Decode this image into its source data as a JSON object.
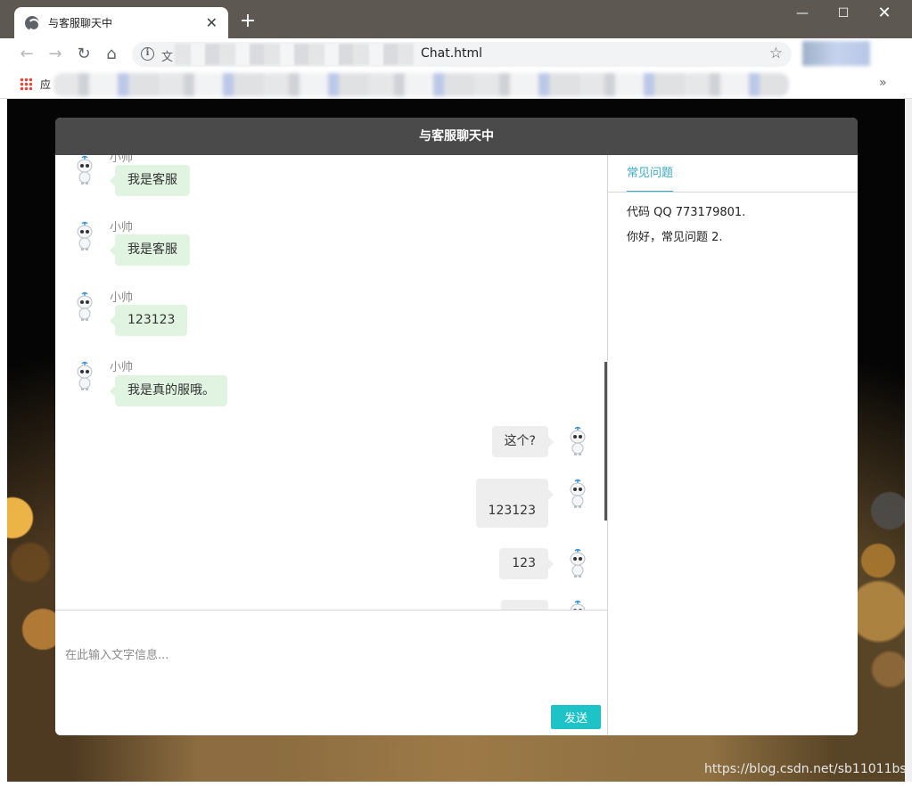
{
  "browser": {
    "tab_title": "与客服聊天中",
    "tab_close": "✕",
    "new_tab": "+",
    "url_scheme_char": "文",
    "url_tail": "Chat.html",
    "apps_label": "应",
    "bookmarks_more": "»",
    "window_controls": {
      "minimize": "—",
      "maximize": "☐",
      "close": "✕"
    },
    "info_icon": "i",
    "star": "☆",
    "nav": {
      "back": "←",
      "forward": "→",
      "reload": "↻",
      "home": "⌂"
    }
  },
  "chat": {
    "header_title": "与客服聊天中",
    "messages": [
      {
        "side": "left",
        "sender": "小帅",
        "text": "我是客服"
      },
      {
        "side": "left",
        "sender": "小帅",
        "text": "我是客服"
      },
      {
        "side": "left",
        "sender": "小帅",
        "text": "123123"
      },
      {
        "side": "left",
        "sender": "小帅",
        "text": "我是真的服哦。"
      },
      {
        "side": "right",
        "text": "这个?"
      },
      {
        "side": "right",
        "text": "123123"
      },
      {
        "side": "right",
        "text": "123"
      },
      {
        "side": "right",
        "text": ""
      }
    ],
    "input_placeholder": "在此输入文字信息...",
    "send_label": "发送"
  },
  "sidebar": {
    "tab_label": "常见问题",
    "items": [
      "代码 QQ 773179801.",
      "你好，常见问题 2."
    ]
  },
  "watermark": "https://blog.csdn.net/sb11011bs",
  "colors": {
    "header_bg": "#4a4a4a",
    "left_bubble": "#e1f4e1",
    "right_bubble": "#eeeeee",
    "send_button": "#1ec3c8",
    "faq_accent": "#3aa9c8"
  }
}
